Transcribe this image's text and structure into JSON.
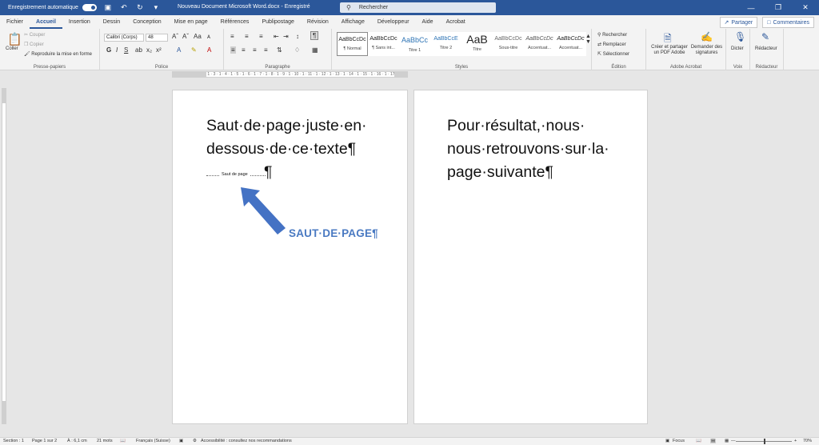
{
  "titlebar": {
    "autosave_label": "Enregistrement automatique",
    "doc_title": "Nouveau Document Microsoft Word.docx  -  Enregistré",
    "search_placeholder": "Rechercher"
  },
  "tabs": [
    "Fichier",
    "Accueil",
    "Insertion",
    "Dessin",
    "Conception",
    "Mise en page",
    "Références",
    "Publipostage",
    "Révision",
    "Affichage",
    "Développeur",
    "Aide",
    "Acrobat"
  ],
  "share": {
    "share_label": "Partager",
    "comments_label": "Commentaires"
  },
  "ribbon": {
    "clipboard": {
      "paste": "Coller",
      "cut": "Couper",
      "copy": "Copier",
      "format_painter": "Reproduire la mise en forme",
      "label": "Presse-papiers"
    },
    "font": {
      "font_name": "Calibri (Corps)",
      "font_size": "48",
      "label": "Police"
    },
    "paragraph": {
      "label": "Paragraphe"
    },
    "styles": {
      "label": "Styles",
      "items": [
        {
          "preview": "AaBbCcDc",
          "name": "¶ Normal"
        },
        {
          "preview": "AaBbCcDc",
          "name": "¶ Sans int..."
        },
        {
          "preview": "AaBbCc",
          "name": "Titre 1"
        },
        {
          "preview": "AaBbCcE",
          "name": "Titre 2"
        },
        {
          "preview": "AaB",
          "name": "Titre"
        },
        {
          "preview": "AaBbCcDc",
          "name": "Sous-titre"
        },
        {
          "preview": "AaBbCcDc",
          "name": "Accentuat..."
        },
        {
          "preview": "AaBbCcDc",
          "name": "Accentuat..."
        }
      ]
    },
    "editing": {
      "find": "Rechercher",
      "replace": "Remplacer",
      "select": "Sélectionner",
      "label": "Édition"
    },
    "acrobat": {
      "create": "Créer et partager un PDF Adobe",
      "request": "Demander des signatures",
      "label": "Adobe Acrobat"
    },
    "voice": {
      "dictate": "Dicter",
      "label": "Voix"
    },
    "editor": {
      "editor": "Rédacteur",
      "label": "Rédacteur"
    }
  },
  "ruler": {
    "ticks": "1 · 2 · 1 · 1 · 1 · 2 · 1 · 3 · 1 · 4 · 1 · 5 · 1 · 6 · 1 · 7 · 1 · 8 · 1 · 9 · 1 · 10 · 1 · 11 · 1 · 12 · 1 · 13 · 1 · 14 · 1 · 15 · 1 · 16 · 1 · 17"
  },
  "page1": {
    "text": "Saut·de·page·juste·en· dessous·de·ce·texte¶",
    "page_break_label": "Saut de page",
    "pilcrow": "¶",
    "annotation": "SAUT·DE·PAGE¶"
  },
  "page2": {
    "text": "Pour·résultat,·nous· nous·retrouvons·sur·la· page·suivante¶"
  },
  "status": {
    "section": "Section : 1",
    "page": "Page 1 sur 2",
    "position": "À : 6,1 cm",
    "words": "21 mots",
    "language": "Français (Suisse)",
    "accessibility": "Accessibilité : consultez nos recommandations",
    "focus": "Focus",
    "zoom": "70%"
  }
}
